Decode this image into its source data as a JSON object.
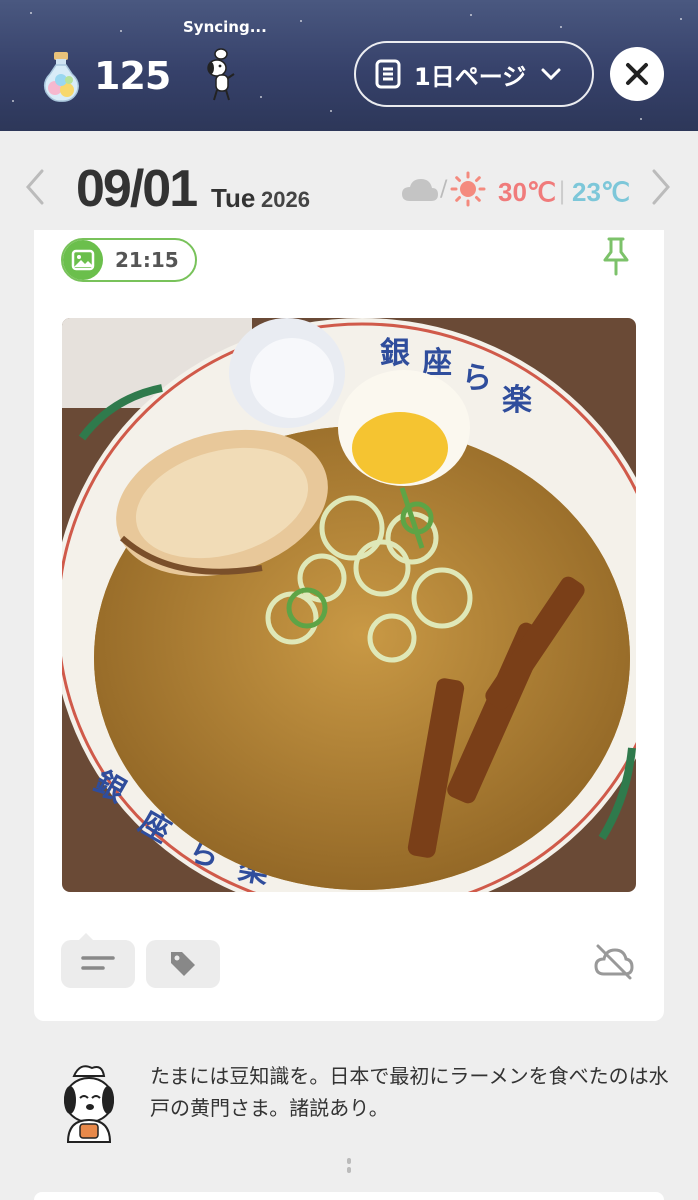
{
  "header": {
    "coin_count": "125",
    "sync_status": "Syncing...",
    "page_selector_label": "1日ページ",
    "icons": [
      "potion-bottle-icon",
      "dog-mascot-icon",
      "document-icon",
      "chevron-down-icon",
      "close-icon"
    ]
  },
  "date_bar": {
    "date": "09/01",
    "weekday": "Tue",
    "year": "2026",
    "weather_icons": [
      "cloud-icon",
      "sun-icon"
    ],
    "weather_separator": "/",
    "temp_high": "30℃",
    "temp_separator": "|",
    "temp_low": "23℃",
    "colors": {
      "temp_high": "#f07b7b",
      "temp_low": "#7dc7d9"
    }
  },
  "entry": {
    "time": "21:15",
    "photo_subject": "ramen bowl",
    "accent_color": "#6bbf4c",
    "icons": [
      "photo-icon",
      "pin-icon",
      "note-icon",
      "tag-icon",
      "cloud-off-icon"
    ]
  },
  "tip": {
    "text": "たまには豆知識を。日本で最初にラーメンを食べたのは水戸の黄門さま。諸説あり。"
  }
}
